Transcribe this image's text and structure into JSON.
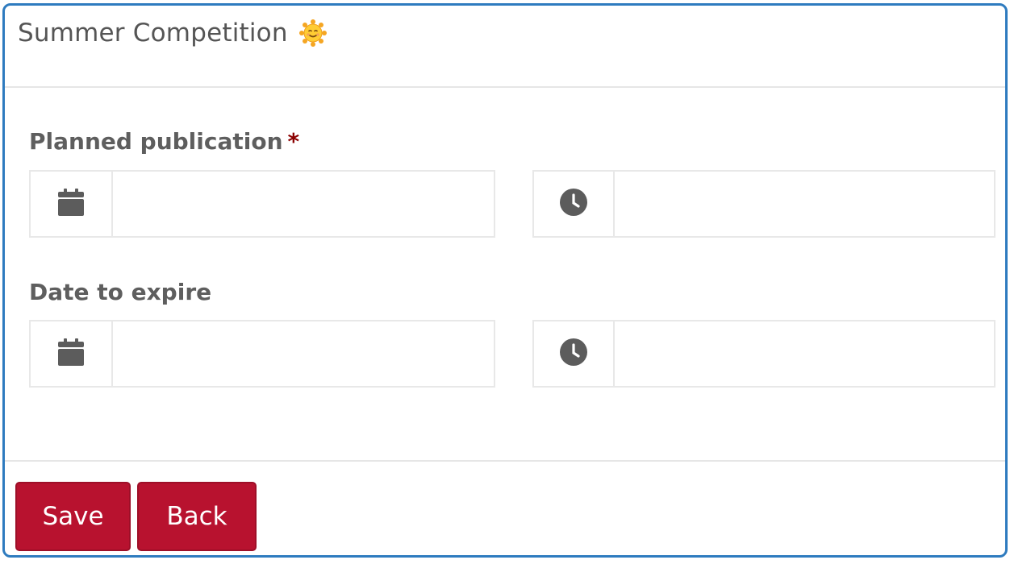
{
  "card": {
    "title": "Summer Competition"
  },
  "fields": {
    "planned": {
      "label": "Planned publication",
      "required_mark": "*",
      "date_value": "",
      "time_value": ""
    },
    "expire": {
      "label": "Date to expire",
      "date_value": "",
      "time_value": ""
    }
  },
  "footer": {
    "save_label": "Save",
    "back_label": "Back"
  },
  "colors": {
    "border_accent": "#2e7bbf",
    "button_bg": "#b8122f",
    "required": "#8b0000"
  },
  "icons": {
    "title_emoji": "smiling-sun-icon",
    "date": "calendar-icon",
    "time": "clock-icon"
  }
}
